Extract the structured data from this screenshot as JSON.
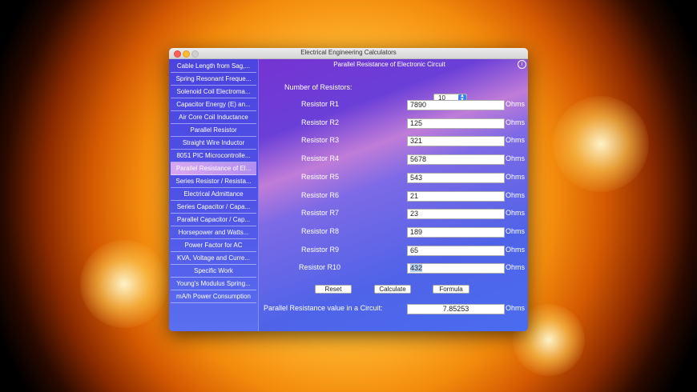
{
  "window": {
    "title": "Electrical Engineering Calculators"
  },
  "sidebar": {
    "items": [
      "Cable Length from Sag,...",
      "Spring Resonant Freque...",
      "Solenoid Coil Electroma...",
      "Capacitor Energy (E) an...",
      "Air Core Coil Inductance",
      "Parallel Resistor",
      "Straight Wire Inductor",
      "8051 PIC Microcontrolle...",
      "Parallel Resistance of El...",
      "Series Resistor / Resista...",
      "Electrical Admittance",
      "Series Capacitor / Capa...",
      "Parallel Capacitor / Cap...",
      "Horsepower and Watts...",
      "Power Factor for AC",
      "KVA, Voltage and Curre...",
      "Specific Work",
      "Young's Modulus Spring...",
      "mA/h Power Consumption"
    ],
    "selected_index": 8
  },
  "panel": {
    "title": "Parallel Resistance of Electronic Circuit",
    "info_icon": "info-icon",
    "num_resistors_label": "Number of Resistors:",
    "num_resistors_value": "10",
    "unit": "Ohms",
    "resistors": [
      {
        "label": "Resistor R1",
        "value": "7890"
      },
      {
        "label": "Resistor R2",
        "value": "125"
      },
      {
        "label": "Resistor R3",
        "value": "321"
      },
      {
        "label": "Resistor R4",
        "value": "5678"
      },
      {
        "label": "Resistor R5",
        "value": "543"
      },
      {
        "label": "Resistor R6",
        "value": "21"
      },
      {
        "label": "Resistor R7",
        "value": "23"
      },
      {
        "label": "Resistor R8",
        "value": "189"
      },
      {
        "label": "Resistor R9",
        "value": "65"
      },
      {
        "label": "Resistor R10",
        "value": "432"
      }
    ],
    "buttons": {
      "reset": "Reset",
      "calculate": "Calculate",
      "formula": "Formula"
    },
    "result_label": "Parallel Resistance value in a Circuit:",
    "result_value": "7.85253",
    "result_unit": "Ohms"
  }
}
